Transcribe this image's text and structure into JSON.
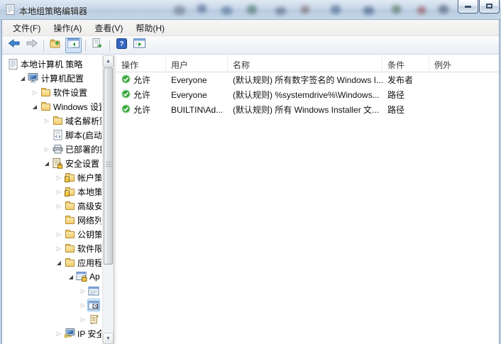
{
  "window": {
    "title": "本地组策略编辑器"
  },
  "menu_bar": {
    "items": [
      {
        "label": "文件(F)"
      },
      {
        "label": "操作(A)"
      },
      {
        "label": "查看(V)"
      },
      {
        "label": "帮助(H)"
      }
    ]
  },
  "toolbar": {
    "buttons": [
      {
        "icon": "back-arrow-icon",
        "pressed": false
      },
      {
        "icon": "forward-arrow-icon",
        "pressed": false
      },
      {
        "icon": "up-one-level-icon",
        "pressed": false
      },
      {
        "icon": "show-console-tree-icon",
        "pressed": true
      },
      {
        "icon": "export-list-icon",
        "pressed": false
      },
      {
        "icon": "help-icon",
        "pressed": false
      },
      {
        "icon": "show-action-pane-icon",
        "pressed": false
      }
    ]
  },
  "tree": {
    "items": [
      {
        "label": "本地计算机 策略",
        "level": 0,
        "state": "leaf",
        "icon": "policy-document-icon",
        "selected": false
      },
      {
        "label": "计算机配置",
        "level": 1,
        "state": "expanded",
        "icon": "computer-icon",
        "selected": false
      },
      {
        "label": "软件设置",
        "level": 2,
        "state": "collapsed",
        "icon": "folder-icon",
        "selected": false
      },
      {
        "label": "Windows 设置",
        "level": 2,
        "state": "expanded",
        "icon": "folder-icon",
        "selected": false
      },
      {
        "label": "域名解析策",
        "level": 3,
        "state": "collapsed",
        "icon": "folder-icon",
        "selected": false
      },
      {
        "label": "脚本(启动/",
        "level": 3,
        "state": "leaf",
        "icon": "script-icon",
        "selected": false
      },
      {
        "label": "已部署的打",
        "level": 3,
        "state": "collapsed",
        "icon": "printer-icon",
        "selected": false
      },
      {
        "label": "安全设置",
        "level": 3,
        "state": "expanded",
        "icon": "security-settings-icon",
        "selected": false
      },
      {
        "label": "帐户策",
        "level": 4,
        "state": "collapsed",
        "icon": "folder-lock-icon",
        "selected": false
      },
      {
        "label": "本地策",
        "level": 4,
        "state": "collapsed",
        "icon": "folder-lock-icon",
        "selected": false
      },
      {
        "label": "高级安",
        "level": 4,
        "state": "collapsed",
        "icon": "folder-icon",
        "selected": false
      },
      {
        "label": "网络列",
        "level": 4,
        "state": "leaf",
        "icon": "folder-icon",
        "selected": false
      },
      {
        "label": "公钥策",
        "level": 4,
        "state": "collapsed",
        "icon": "folder-icon",
        "selected": false
      },
      {
        "label": "软件限",
        "level": 4,
        "state": "collapsed",
        "icon": "folder-icon",
        "selected": false
      },
      {
        "label": "应用程",
        "level": 4,
        "state": "expanded",
        "icon": "folder-icon",
        "selected": false
      },
      {
        "label": "Ap",
        "level": 5,
        "state": "expanded",
        "icon": "applocker-icon",
        "selected": false
      },
      {
        "label": "",
        "level": 6,
        "state": "collapsed",
        "icon": "executable-rules-icon",
        "selected": false
      },
      {
        "label": "",
        "level": 6,
        "state": "collapsed",
        "icon": "installer-rules-icon",
        "selected": true
      },
      {
        "label": "",
        "level": 6,
        "state": "collapsed",
        "icon": "script-rules-icon",
        "selected": false
      },
      {
        "label": "IP 安全",
        "level": 4,
        "state": "collapsed",
        "icon": "ip-security-icon",
        "selected": false
      }
    ]
  },
  "list": {
    "columns": [
      {
        "label": "操作"
      },
      {
        "label": "用户"
      },
      {
        "label": "名称"
      },
      {
        "label": "条件"
      },
      {
        "label": "例外"
      }
    ],
    "rows": [
      {
        "action": "允许",
        "action_icon": "allow-check-icon",
        "user": "Everyone",
        "name": "(默认规则) 所有数字签名的 Windows I...",
        "condition": "发布者",
        "exception": ""
      },
      {
        "action": "允许",
        "action_icon": "allow-check-icon",
        "user": "Everyone",
        "name": "(默认规则) %systemdrive%\\Windows...",
        "condition": "路径",
        "exception": ""
      },
      {
        "action": "允许",
        "action_icon": "allow-check-icon",
        "user": "BUILTIN\\Ad...",
        "name": "(默认规则) 所有 Windows Installer 文...",
        "condition": "路径",
        "exception": ""
      }
    ]
  }
}
